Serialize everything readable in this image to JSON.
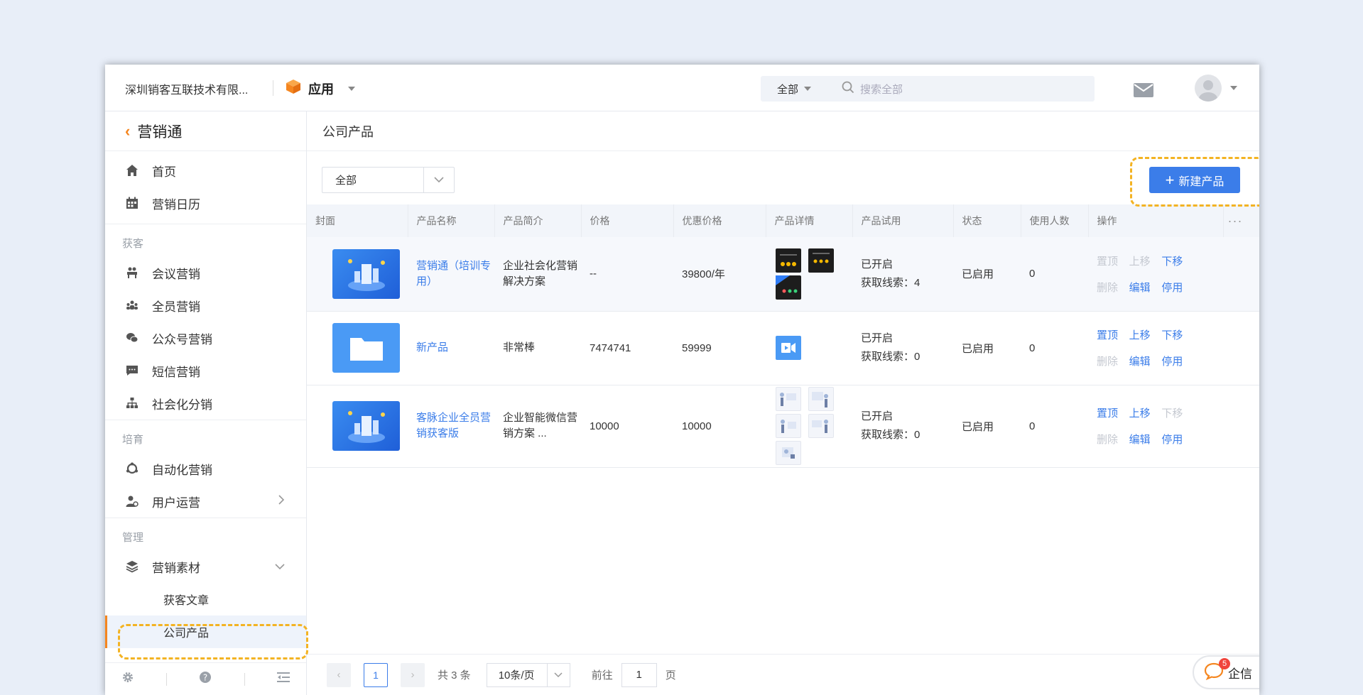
{
  "topbar": {
    "company": "深圳销客互联技术有限...",
    "app_label": "应用",
    "search_scope": "全部",
    "search_placeholder": "搜索全部"
  },
  "sidebar": {
    "title": "营销通",
    "top_items": [
      {
        "label": "首页",
        "icon": "home-icon"
      },
      {
        "label": "营销日历",
        "icon": "calendar-icon"
      }
    ],
    "groups": [
      {
        "label": "获客",
        "items": [
          {
            "label": "会议营销",
            "icon": "meeting-icon"
          },
          {
            "label": "全员营销",
            "icon": "team-icon"
          },
          {
            "label": "公众号营销",
            "icon": "wechat-icon"
          },
          {
            "label": "短信营销",
            "icon": "sms-icon"
          },
          {
            "label": "社会化分销",
            "icon": "org-tree-icon"
          }
        ]
      },
      {
        "label": "培育",
        "items": [
          {
            "label": "自动化营销",
            "icon": "automation-icon"
          },
          {
            "label": "用户运营",
            "icon": "user-ops-icon"
          }
        ]
      },
      {
        "label": "管理",
        "items": [
          {
            "label": "营销素材",
            "icon": "layers-icon"
          }
        ]
      }
    ],
    "sub_items": [
      "获客文章",
      "公司产品"
    ]
  },
  "main": {
    "title": "公司产品",
    "filter_value": "全部",
    "new_button": "新建产品",
    "columns": [
      "封面",
      "产品名称",
      "产品简介",
      "价格",
      "优惠价格",
      "产品详情",
      "产品试用",
      "状态",
      "使用人数",
      "操作"
    ],
    "rows": [
      {
        "name": "营销通（培训专用）",
        "intro": "企业社会化营销解决方案",
        "price": "--",
        "discount": "39800/年",
        "trial": "已开启",
        "leads": "获取线索：4",
        "status": "已启用",
        "users": "0",
        "ops": [
          "置顶",
          "上移",
          "下移",
          "删除",
          "编辑",
          "停用"
        ],
        "ops_enabled": [
          false,
          false,
          true,
          false,
          true,
          true
        ]
      },
      {
        "name": "新产品",
        "intro": "非常棒",
        "price": "7474741",
        "discount": "59999",
        "trial": "已开启",
        "leads": "获取线索：0",
        "status": "已启用",
        "users": "0",
        "ops": [
          "置顶",
          "上移",
          "下移",
          "删除",
          "编辑",
          "停用"
        ],
        "ops_enabled": [
          true,
          true,
          true,
          false,
          true,
          true
        ]
      },
      {
        "name": "客脉企业全员营销获客版",
        "intro": "企业智能微信营销方案 ...",
        "price": "10000",
        "discount": "10000",
        "trial": "已开启",
        "leads": "获取线索：0",
        "status": "已启用",
        "users": "0",
        "ops": [
          "置顶",
          "上移",
          "下移",
          "删除",
          "编辑",
          "停用"
        ],
        "ops_enabled": [
          true,
          true,
          false,
          false,
          true,
          true
        ]
      }
    ]
  },
  "pager": {
    "current": "1",
    "total": "共 3 条",
    "page_size": "10条/页",
    "goto_label": "前往",
    "goto_value": "1",
    "page_unit": "页"
  },
  "chat": {
    "label": "企信",
    "badge": "5"
  },
  "colors": {
    "accent": "#3b7de9",
    "brand_orange": "#f5861f",
    "highlight": "#f3b323"
  }
}
